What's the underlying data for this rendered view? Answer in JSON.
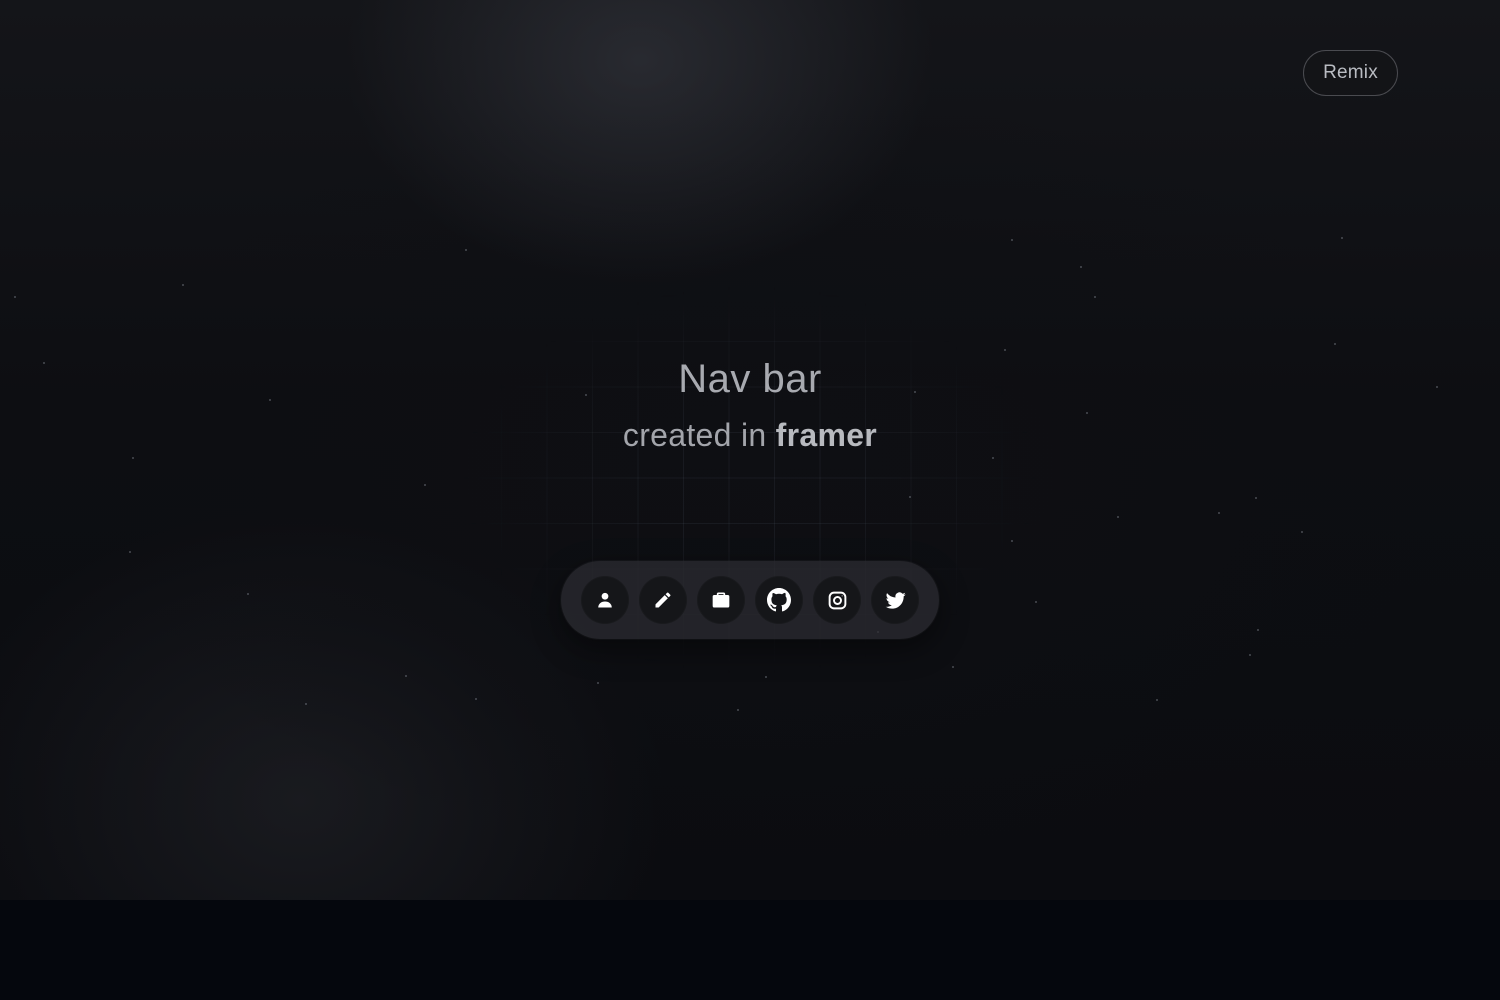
{
  "header": {
    "remix_label": "Remix"
  },
  "hero": {
    "title": "Nav bar",
    "subtitle_prefix": "created in ",
    "subtitle_brand": "framer"
  },
  "navbar": {
    "items": [
      {
        "icon": "person-icon"
      },
      {
        "icon": "pencil-icon"
      },
      {
        "icon": "briefcase-icon"
      },
      {
        "icon": "github-icon"
      },
      {
        "icon": "instagram-icon"
      },
      {
        "icon": "twitter-icon"
      }
    ]
  },
  "colors": {
    "background": "#0b0c10",
    "navbar_bg": "#2c2d32",
    "icon_button_bg": "#151619",
    "icon_fill": "#ffffff",
    "text_muted": "#a8aab0"
  }
}
